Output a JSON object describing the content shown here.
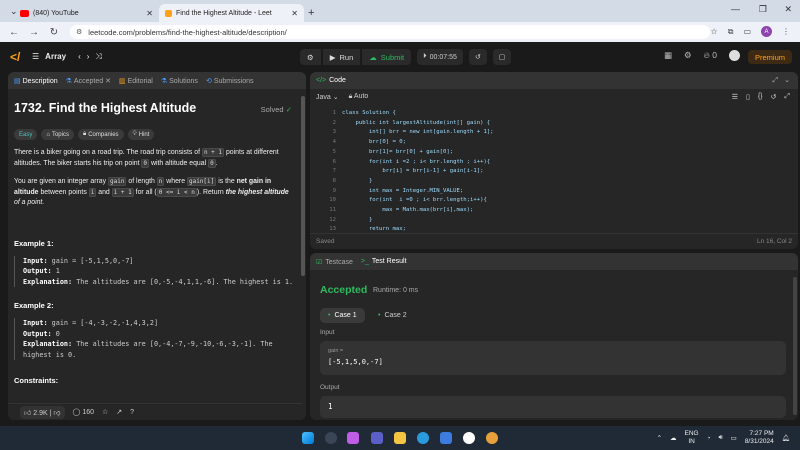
{
  "browser": {
    "tabs": [
      {
        "label": "(840) YouTube",
        "active": false
      },
      {
        "label": "Find the Highest Altitude - Leet",
        "active": true
      }
    ],
    "url": "leetcode.com/problems/find-the-highest-altitude/description/"
  },
  "lc_nav": {
    "problem_list": "Array",
    "run_label": "Run",
    "submit_label": "Submit",
    "timer": "00:07:55",
    "streak": "0",
    "premium_label": "Premium"
  },
  "desc_panel": {
    "tabs": [
      "Description",
      "Accepted",
      "Editorial",
      "Solutions",
      "Submissions"
    ],
    "title": "1732. Find the Highest Altitude",
    "solved": "Solved",
    "tags": [
      "Easy",
      "Topics",
      "Companies",
      "Hint"
    ],
    "p1_a": "There is a biker going on a road trip. The road trip consists of",
    "p1_code1": "n + 1",
    "p1_b": "points at different altitudes. The biker starts his trip on point",
    "p1_code2": "0",
    "p1_c": "with altitude equal",
    "p1_code3": "0",
    "p1_d": ".",
    "p2_a": "You are given an integer array",
    "p2_code1": "gain",
    "p2_b": "of length",
    "p2_code2": "n",
    "p2_c": "where",
    "p2_code3": "gain[i]",
    "p2_d": "is the",
    "p2_bold1": "net gain in altitude",
    "p2_e": "between points",
    "p2_code4": "i",
    "p2_f": "and",
    "p2_code5": "i + 1",
    "p2_g": "for all (",
    "p2_code6": "0 <= i < n",
    "p2_h": "). Return",
    "p2_bold2": "the highest altitude",
    "p2_i": "of a point.",
    "examples": [
      {
        "heading": "Example 1:",
        "input_label": "Input:",
        "input": "gain = [-5,1,5,0,-7]",
        "output_label": "Output:",
        "output": "1",
        "expl_label": "Explanation:",
        "expl": "The altitudes are [0,-5,-4,1,1,-6]. The highest is 1."
      },
      {
        "heading": "Example 2:",
        "input_label": "Input:",
        "input": "gain = [-4,-3,-2,-1,4,3,2]",
        "output_label": "Output:",
        "output": "0",
        "expl_label": "Explanation:",
        "expl": "The altitudes are [0,-4,-7,-9,-10,-6,-3,-1]. The highest is 0."
      }
    ],
    "constraints_heading": "Constraints:",
    "likes": "2.9K",
    "comments": "160"
  },
  "code_panel": {
    "tab": "Code",
    "language": "Java",
    "mode": "Auto",
    "lines": [
      "class Solution {",
      "    public int largestAltitude(int[] gain) {",
      "        int[] brr = new int[gain.length + 1];",
      "        brr[0] = 0;",
      "        brr[1]= brr[0] + gain[0];",
      "        for(int i =2 ; i< brr.length ; i++){",
      "            brr[i] = brr[i-1] + gain[i-1];",
      "        }",
      "        int max = Integer.MIN_VALUE;",
      "        for(int  i =0 ; i< brr.length;i++){",
      "            max = Math.max(brr[i],max);",
      "        }",
      "        return max;"
    ],
    "status": "Saved",
    "cursor": "Ln 16, Col 2"
  },
  "result_panel": {
    "tabs": [
      "Testcase",
      "Test Result"
    ],
    "verdict": "Accepted",
    "runtime": "Runtime: 0 ms",
    "cases": [
      "Case 1",
      "Case 2"
    ],
    "input_label": "Input",
    "param_name": "gain =",
    "param_value": "[-5,1,5,0,-7]",
    "output_label": "Output",
    "output_value": "1"
  },
  "taskbar": {
    "lang": "ENG",
    "region": "IN",
    "time": "7:27 PM",
    "date": "8/31/2024"
  },
  "colors": {
    "accent": "#ffa116",
    "accepted": "#2cbb5d",
    "easy": "#46c6c2"
  }
}
